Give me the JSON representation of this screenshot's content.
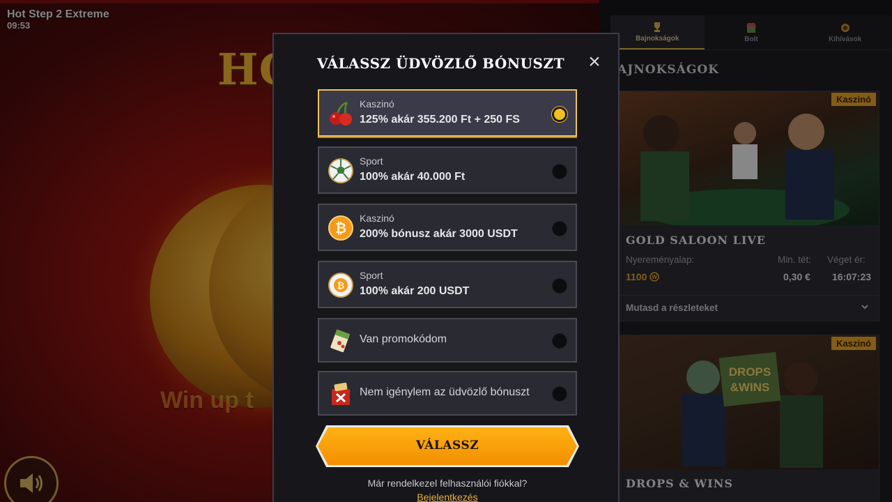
{
  "game": {
    "title": "Hot Step 2 Extreme",
    "time": "09:53",
    "logo_text": "HOT STEP EX",
    "banner_text": "Win up t"
  },
  "panel": {
    "tabs": [
      {
        "label": "Bajnokságok",
        "icon": "trophy-icon",
        "active": true
      },
      {
        "label": "Bolt",
        "icon": "shop-icon",
        "active": false
      },
      {
        "label": "Kihívások",
        "icon": "challenge-icon",
        "active": false
      }
    ],
    "heading": "AJNOKSÁGOK",
    "cards": [
      {
        "tag": "Kaszinó",
        "name": "GOLD SALOON LIVE",
        "prize_label": "Nyereményalap:",
        "prize_value": "1100",
        "min_bet_label": "Min. tét:",
        "min_bet_value": "0,30 €",
        "ends_label": "Véget ér:",
        "ends_value": "16:07:23",
        "details_label": "Mutasd a részleteket"
      },
      {
        "tag": "Kaszinó",
        "name": "DROPS & WINS",
        "image_text": "DROPS & WINS"
      }
    ]
  },
  "modal": {
    "title": "VÁLASSZ ÜDVÖZLŐ BÓNUSZT",
    "close_label": "×",
    "options": [
      {
        "category": "Kaszinó",
        "description": "125% akár 355.200 Ft + 250 FS",
        "icon": "cherry-icon",
        "selected": true
      },
      {
        "category": "Sport",
        "description": "100% akár 40.000 Ft",
        "icon": "football-icon",
        "selected": false
      },
      {
        "category": "Kaszinó",
        "description": "200% bónusz akár 3000 USDT",
        "icon": "bitcoin-icon",
        "selected": false
      },
      {
        "category": "Sport",
        "description": "100% akár 200 USDT",
        "icon": "bitcoin-football-icon",
        "selected": false
      },
      {
        "category": "",
        "description": "Van promokódom",
        "icon": "promo-ticket-icon",
        "selected": false
      },
      {
        "category": "",
        "description": "Nem igénylem az üdvözlő bónuszt",
        "icon": "no-bonus-icon",
        "selected": false
      }
    ],
    "choose_button": "VÁLASSZ",
    "account_question": "Már rendelkezel felhasználói fiókkal?",
    "login_link": "Bejelentkezés"
  },
  "colors": {
    "accent": "#f2c01a",
    "button": "#f59a05",
    "tag": "#e7a321"
  }
}
